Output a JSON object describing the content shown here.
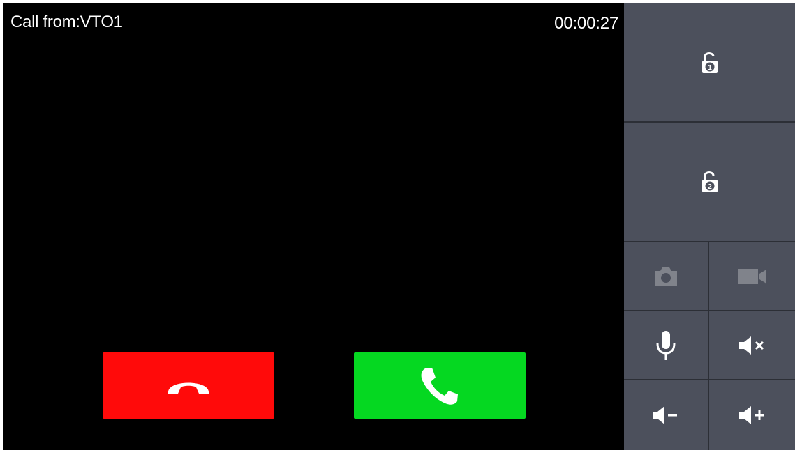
{
  "call": {
    "caller_label": "Call from:VTO1",
    "duration": "00:00:27"
  },
  "colors": {
    "background": "#000000",
    "panel": "#4c505c",
    "divider": "#2c2f36",
    "hangup": "#ff0a0a",
    "answer": "#05d821",
    "icon_active": "#ffffff",
    "icon_disabled": "#80838b"
  },
  "controls": {
    "hangup": {
      "icon": "phone-hangup-icon"
    },
    "answer": {
      "icon": "phone-answer-icon"
    },
    "unlock_1": {
      "icon": "unlock-icon",
      "number": "1"
    },
    "unlock_2": {
      "icon": "unlock-icon",
      "number": "2"
    },
    "snapshot": {
      "icon": "camera-icon",
      "enabled": false
    },
    "record": {
      "icon": "video-camera-icon",
      "enabled": false
    },
    "mic": {
      "icon": "microphone-icon",
      "enabled": true
    },
    "mute": {
      "icon": "speaker-mute-icon",
      "enabled": true
    },
    "volume_down": {
      "icon": "volume-down-icon",
      "enabled": true
    },
    "volume_up": {
      "icon": "volume-up-icon",
      "enabled": true
    }
  }
}
